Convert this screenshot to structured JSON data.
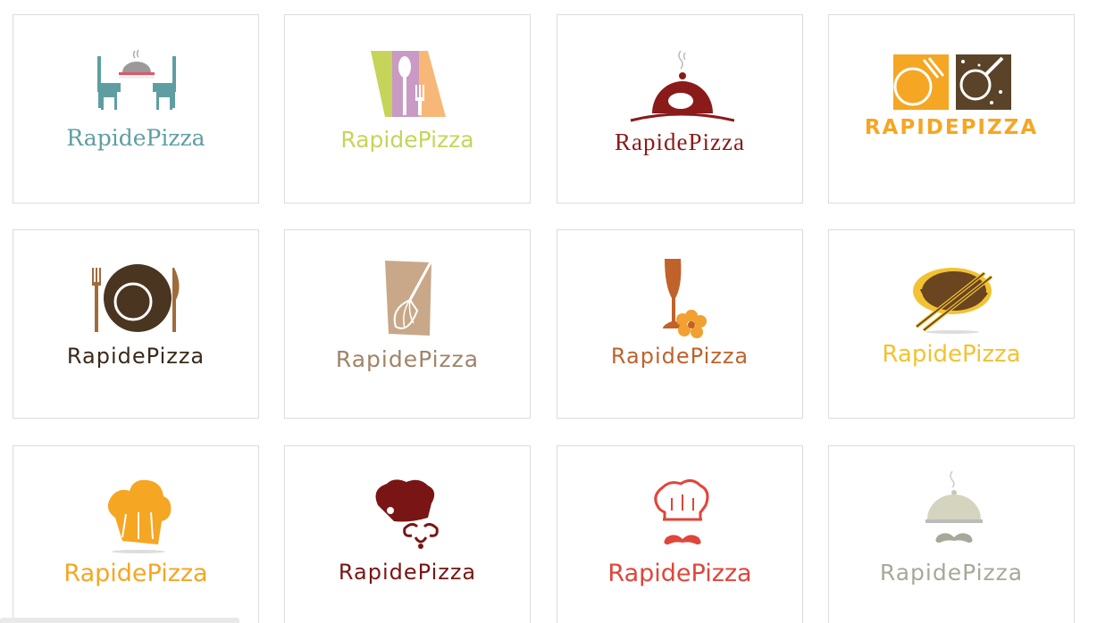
{
  "brand_name": "RapidePizza",
  "logos": [
    {
      "text": "RapidePizza",
      "color": "#5e9ea2",
      "icon": "dining-table-chairs-icon"
    },
    {
      "text": "RapidePizza",
      "color": "#c6d45a",
      "icon": "spoon-fork-panels-icon"
    },
    {
      "text": "RapidePizza",
      "color": "#8b1a1a",
      "icon": "cloche-chicken-icon"
    },
    {
      "text": "RAPIDEPIZZA",
      "color": "#f5a623",
      "icon": "plate-pan-squares-icon"
    },
    {
      "text": "RapidePizza",
      "color": "#3a2a1a",
      "icon": "plate-fork-knife-icon"
    },
    {
      "text": "RapidePizza",
      "color": "#a08468",
      "icon": "whisk-icon"
    },
    {
      "text": "RapidePizza",
      "color": "#c0622a",
      "icon": "wine-glass-flower-icon"
    },
    {
      "text": "RapidePizza",
      "color": "#f2c232",
      "icon": "bowl-chopsticks-icon"
    },
    {
      "text": "RapidePizza",
      "color": "#f5a623",
      "icon": "chef-hat-icon"
    },
    {
      "text": "RapidePizza",
      "color": "#7a1515",
      "icon": "chef-hat-mustache-icon"
    },
    {
      "text": "RapidePizza",
      "color": "#e0453a",
      "icon": "chef-outline-mustache-icon"
    },
    {
      "text": "RapidePizza",
      "color": "#a8a89a",
      "icon": "cloche-mustache-icon"
    }
  ]
}
